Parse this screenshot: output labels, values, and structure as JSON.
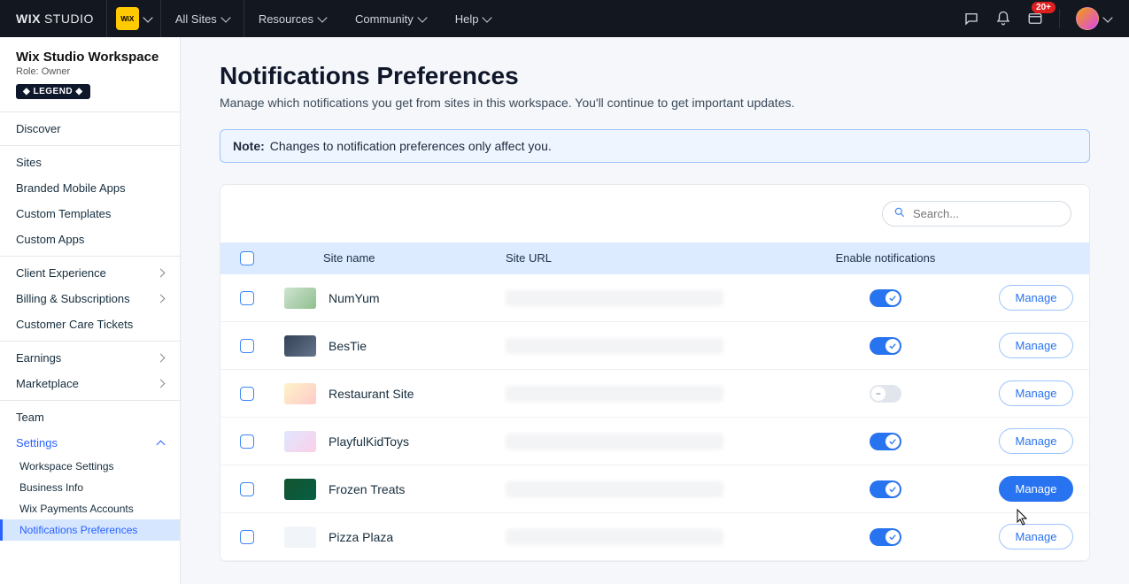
{
  "topbar": {
    "logo_wix": "WIX",
    "logo_studio": "STUDIO",
    "nav": [
      "All Sites",
      "Resources",
      "Community",
      "Help"
    ],
    "notif_badge": "20+"
  },
  "sidebar": {
    "workspace_title": "Wix Studio Workspace",
    "role": "Role: Owner",
    "legend": "◆ LEGEND ◆",
    "groups": {
      "discover": "Discover",
      "sites": "Sites",
      "branded": "Branded Mobile Apps",
      "templates": "Custom Templates",
      "apps": "Custom Apps",
      "client_exp": "Client Experience",
      "billing": "Billing & Subscriptions",
      "tickets": "Customer Care Tickets",
      "earnings": "Earnings",
      "marketplace": "Marketplace",
      "team": "Team",
      "settings": "Settings"
    },
    "settings_sub": [
      "Workspace Settings",
      "Business Info",
      "Wix Payments Accounts",
      "Notifications Preferences"
    ]
  },
  "page": {
    "title": "Notifications Preferences",
    "subtitle": "Manage which notifications you get from sites in this workspace. You'll continue to get important updates.",
    "note_label": "Note:",
    "note_text": "Changes to notification preferences only affect you."
  },
  "table": {
    "search_placeholder": "Search...",
    "cols": {
      "name": "Site name",
      "url": "Site URL",
      "enable": "Enable notifications"
    },
    "manage_label": "Manage",
    "rows": [
      {
        "name": "NumYum",
        "enabled": true,
        "thumb": "t1",
        "hot": false
      },
      {
        "name": "BesTie",
        "enabled": true,
        "thumb": "t2",
        "hot": false
      },
      {
        "name": "Restaurant Site",
        "enabled": false,
        "thumb": "t3",
        "hot": false
      },
      {
        "name": "PlayfulKidToys",
        "enabled": true,
        "thumb": "t4",
        "hot": false
      },
      {
        "name": "Frozen Treats",
        "enabled": true,
        "thumb": "t5",
        "hot": true
      },
      {
        "name": "Pizza Plaza",
        "enabled": true,
        "thumb": "t6",
        "hot": false
      }
    ]
  }
}
